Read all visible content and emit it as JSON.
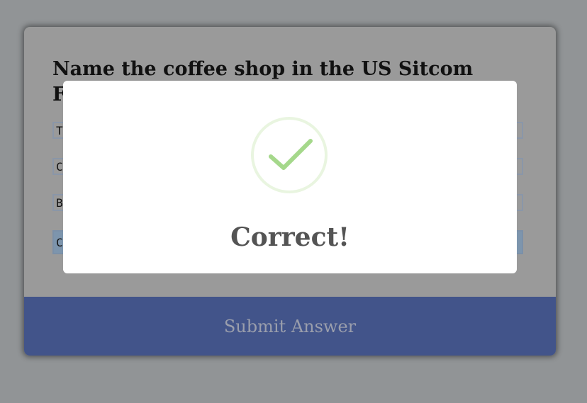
{
  "quiz": {
    "question": "Name the coffee shop in the US Sitcom Friends",
    "options": [
      {
        "label": "T",
        "selected": false
      },
      {
        "label": "C",
        "selected": false
      },
      {
        "label": "B",
        "selected": false
      },
      {
        "label": "C",
        "selected": true
      }
    ],
    "submit_label": "Submit Answer"
  },
  "modal": {
    "icon": "check-icon",
    "message": "Correct!"
  },
  "colors": {
    "submit_bg": "#42548a",
    "check_color": "#a5d88b",
    "ring_color": "#e9f5e0"
  }
}
